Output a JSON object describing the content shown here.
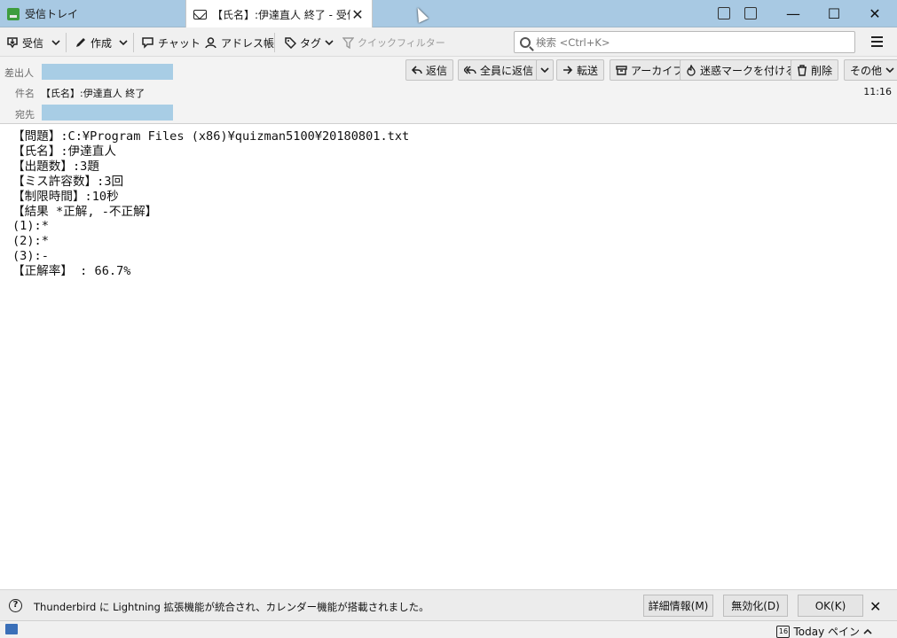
{
  "tabs": [
    {
      "label": "受信トレイ",
      "icon": "inbox-icon"
    },
    {
      "label": "【氏名】:伊達直人 終了 - 受信",
      "icon": "envelope-icon",
      "close": "✕"
    }
  ],
  "window_controls": {
    "minimize": "—",
    "maximize": "☐",
    "close": "✕"
  },
  "toolbar": {
    "get_mail": "受信",
    "write": "作成",
    "chat": "チャット",
    "address_book": "アドレス帳",
    "tag": "タグ",
    "quick_filter": "クイックフィルター",
    "search_placeholder": "検索 <Ctrl+K>"
  },
  "header": {
    "from_label": "差出人",
    "subject_label": "件名",
    "subject": "【氏名】:伊達直人 終了",
    "to_label": "宛先",
    "time": "11:16",
    "buttons": {
      "reply": "返信",
      "reply_all": "全員に返信",
      "forward": "転送",
      "archive": "アーカイブ",
      "junk": "迷惑マークを付ける",
      "delete": "削除",
      "other": "その他"
    }
  },
  "body": {
    "lines": [
      "【問題】:C:¥Program Files (x86)¥quizman5100¥20180801.txt",
      "【氏名】:伊達直人",
      "【出題数】:3題",
      "【ミス許容数】:3回",
      "【制限時間】:10秒",
      "【結果 *正解, -不正解】",
      "(1):*",
      "(2):*",
      "(3):-",
      "【正解率】 : 66.7%"
    ]
  },
  "notification": {
    "icon": "?",
    "text": "Thunderbird に Lightning 拡張機能が統合され、カレンダー機能が搭載されました。",
    "details": "詳細情報(M)",
    "disable": "無効化(D)",
    "ok": "OK(K)",
    "close": "✕"
  },
  "status": {
    "today_pane": "Today ペイン",
    "calendar_day": "16"
  },
  "colors": {
    "tabbar": "#a8c9e3",
    "redaction": "#a8cde5"
  }
}
